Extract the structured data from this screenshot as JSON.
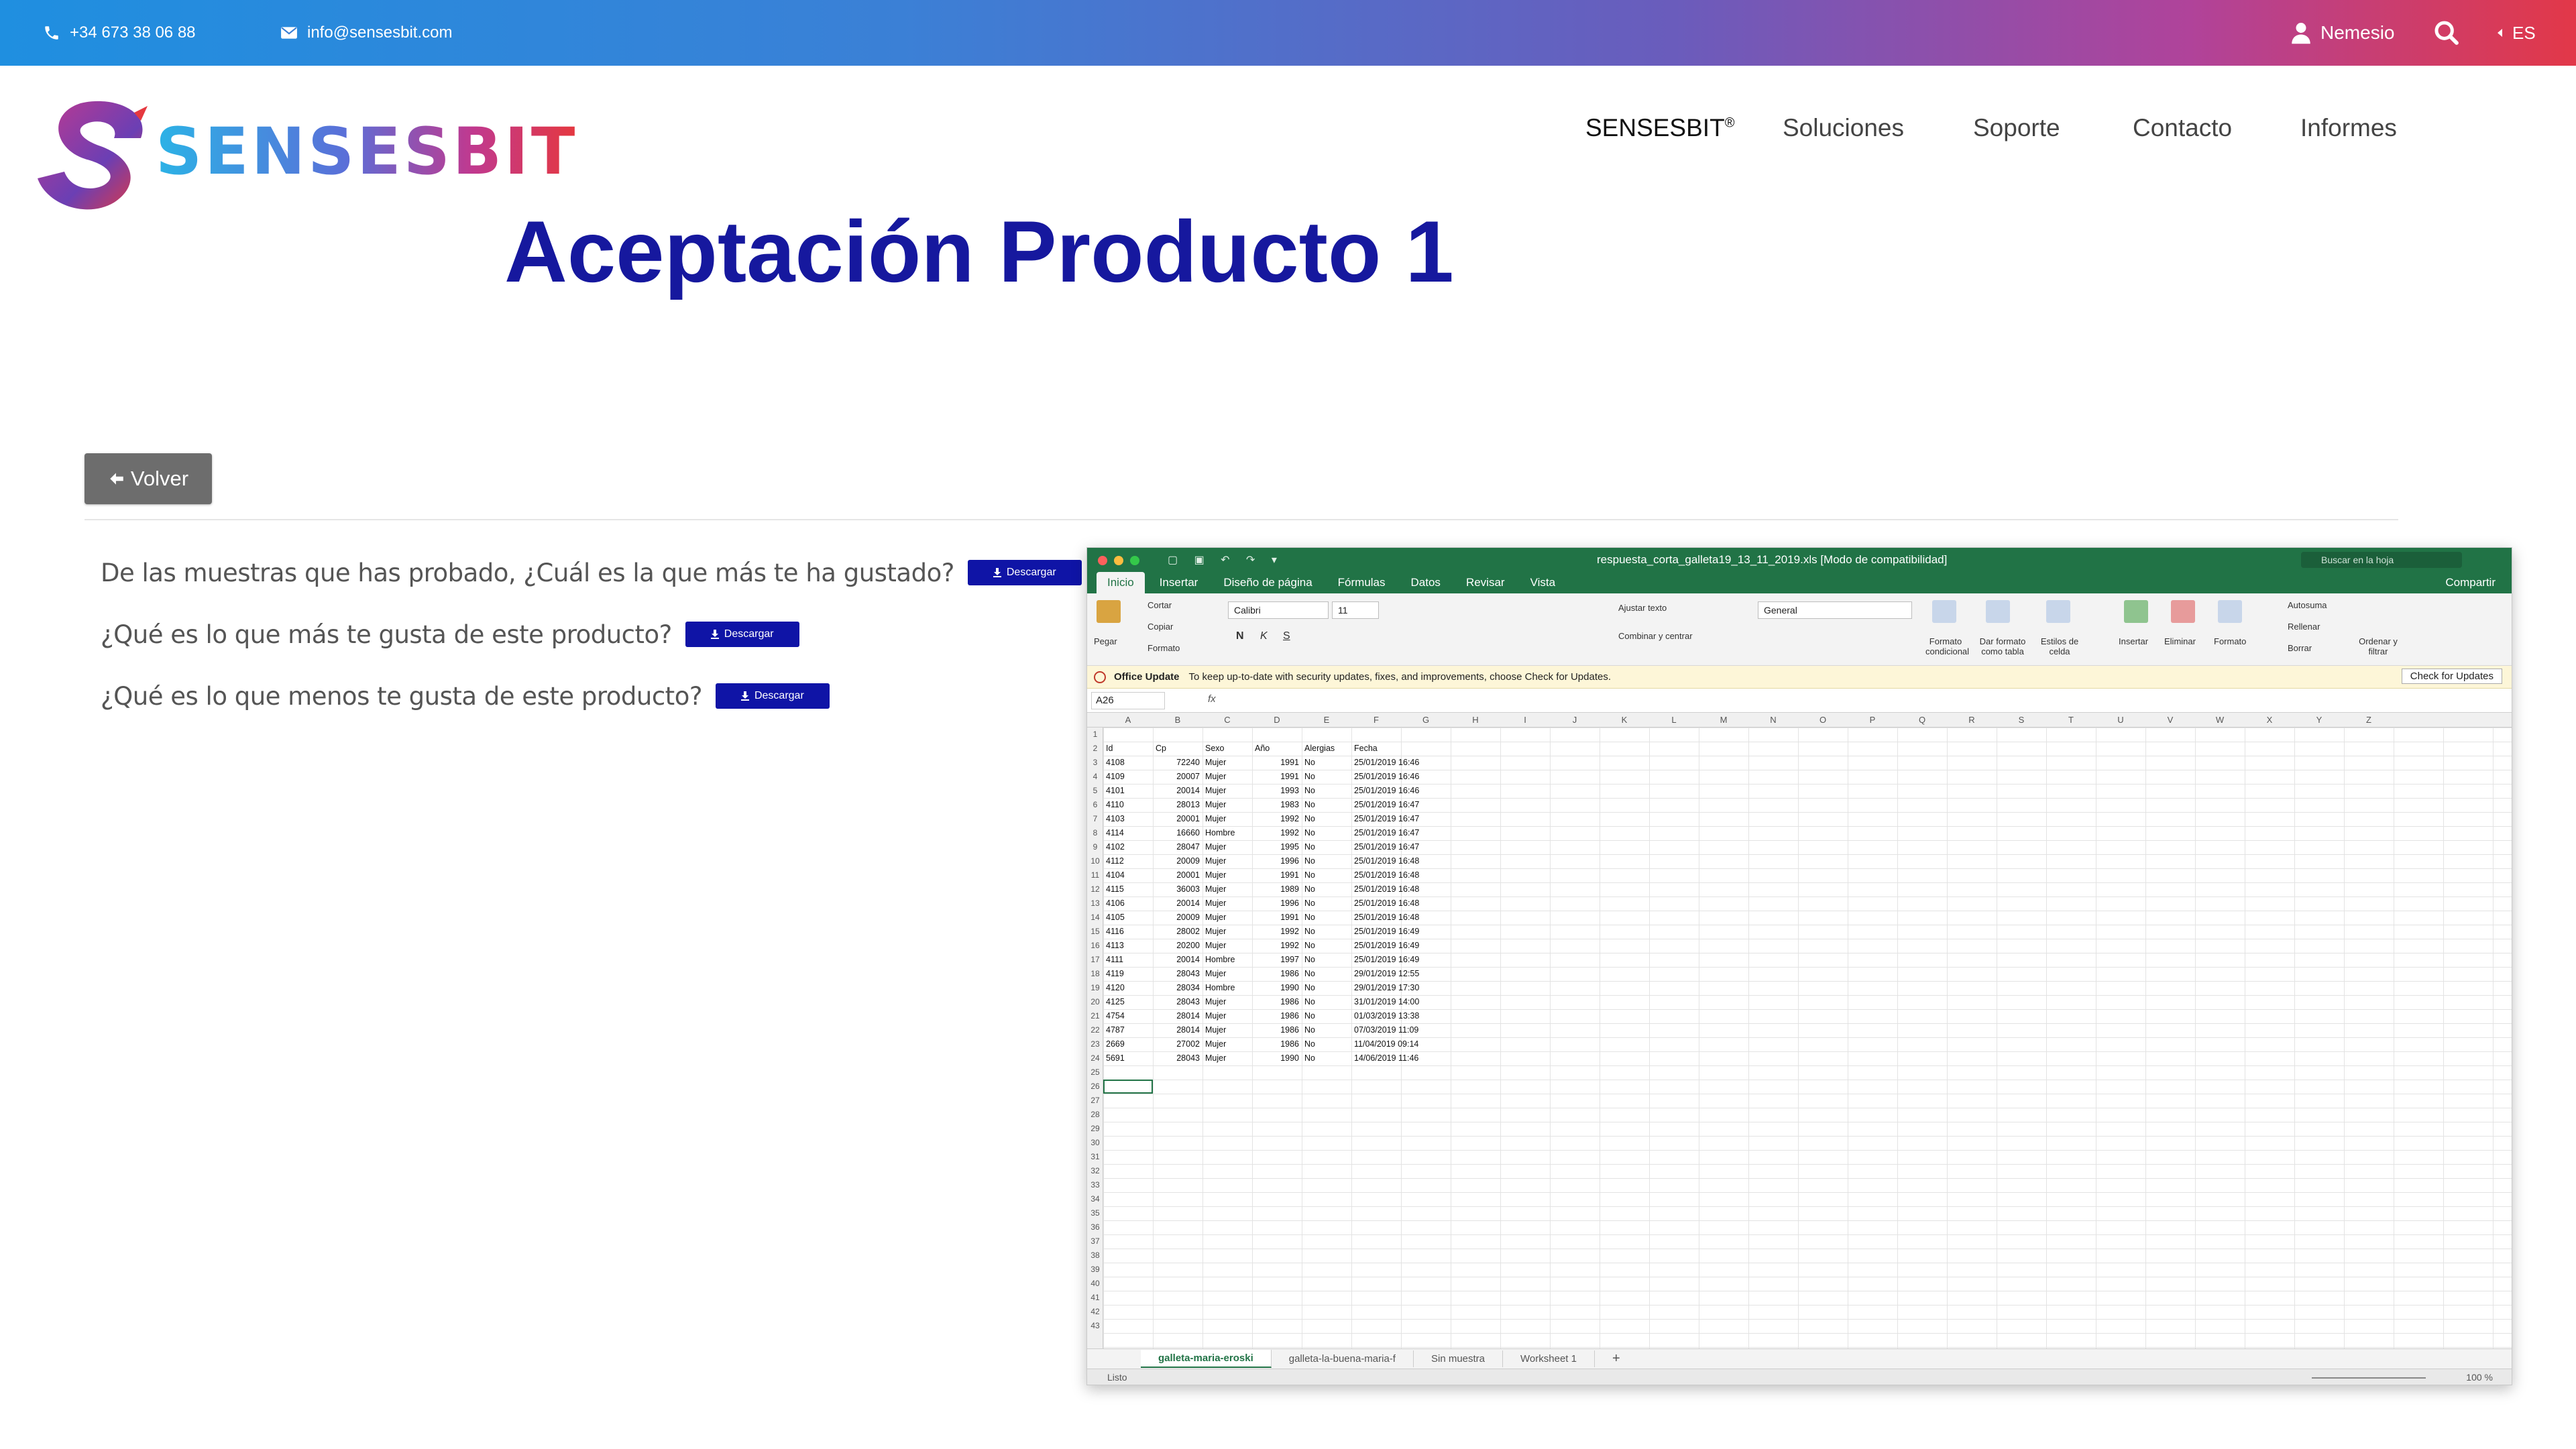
{
  "topbar": {
    "phone": "+34 673 38 06 88",
    "email": "info@sensesbit.com",
    "user": "Nemesio",
    "language": "ES",
    "icons": [
      "phone-icon",
      "mail-icon",
      "user-icon",
      "search-icon",
      "caret-left-icon"
    ]
  },
  "header": {
    "logo_text": "SENSESBIT",
    "nav": [
      {
        "label": "SENSESBIT",
        "sup": "®"
      },
      {
        "label": "Soluciones"
      },
      {
        "label": "Soporte"
      },
      {
        "label": "Contacto"
      },
      {
        "label": "Informes"
      }
    ]
  },
  "page": {
    "title": "Aceptación Producto 1",
    "back_label": "Volver"
  },
  "questions": [
    {
      "text": "De las muestras que has probado, ¿Cuál es la que más te ha gustado?",
      "button": "Descargar"
    },
    {
      "text": "¿Qué es lo que más te gusta de este producto?",
      "button": "Descargar"
    },
    {
      "text": "¿Qué es lo que menos te gusta de este producto?",
      "button": "Descargar"
    }
  ],
  "excel": {
    "document_title": "respuesta_corta_galleta19_13_11_2019.xls  [Modo de compatibilidad]",
    "search_placeholder": "Buscar en la hoja",
    "share": "Compartir",
    "tabs": [
      "Inicio",
      "Insertar",
      "Diseño de página",
      "Fórmulas",
      "Datos",
      "Revisar",
      "Vista"
    ],
    "ribbon": {
      "paste": "Pegar",
      "cut": "Cortar",
      "copy": "Copiar",
      "format_painter": "Formato",
      "font": "Calibri",
      "size": "11",
      "bold": "N",
      "italic": "K",
      "underline": "S",
      "wrap": "Ajustar texto",
      "merge": "Combinar y centrar",
      "number_format": "General",
      "cond_format": "Formato condicional",
      "table_format": "Dar formato como tabla",
      "cell_styles": "Estilos de celda",
      "insert": "Insertar",
      "delete": "Eliminar",
      "format": "Formato",
      "autosum": "Autosuma",
      "fill": "Rellenar",
      "clear": "Borrar",
      "sort": "Ordenar y filtrar"
    },
    "update_bar": {
      "title": "Office Update",
      "message": "To keep up-to-date with security updates, fixes, and improvements, choose Check for Updates.",
      "button": "Check for Updates"
    },
    "name_box": "A26",
    "fx": "fx",
    "columns": [
      "A",
      "B",
      "C",
      "D",
      "E",
      "F",
      "G",
      "H",
      "I",
      "J",
      "K",
      "L",
      "M",
      "N",
      "O",
      "P",
      "Q",
      "R",
      "S",
      "T",
      "U",
      "V",
      "W",
      "X",
      "Y",
      "Z"
    ],
    "headers": [
      "Id",
      "Cp",
      "Sexo",
      "Año",
      "Alergias",
      "Fecha"
    ],
    "rows": [
      [
        "4108",
        "72240",
        "Mujer",
        "1991",
        "No",
        "25/01/2019 16:46"
      ],
      [
        "4109",
        "20007",
        "Mujer",
        "1991",
        "No",
        "25/01/2019 16:46"
      ],
      [
        "4101",
        "20014",
        "Mujer",
        "1993",
        "No",
        "25/01/2019 16:46"
      ],
      [
        "4110",
        "28013",
        "Mujer",
        "1983",
        "No",
        "25/01/2019 16:47"
      ],
      [
        "4103",
        "20001",
        "Mujer",
        "1992",
        "No",
        "25/01/2019 16:47"
      ],
      [
        "4114",
        "16660",
        "Hombre",
        "1992",
        "No",
        "25/01/2019 16:47"
      ],
      [
        "4102",
        "28047",
        "Mujer",
        "1995",
        "No",
        "25/01/2019 16:47"
      ],
      [
        "4112",
        "20009",
        "Mujer",
        "1996",
        "No",
        "25/01/2019 16:48"
      ],
      [
        "4104",
        "20001",
        "Mujer",
        "1991",
        "No",
        "25/01/2019 16:48"
      ],
      [
        "4115",
        "36003",
        "Mujer",
        "1989",
        "No",
        "25/01/2019 16:48"
      ],
      [
        "4106",
        "20014",
        "Mujer",
        "1996",
        "No",
        "25/01/2019 16:48"
      ],
      [
        "4105",
        "20009",
        "Mujer",
        "1991",
        "No",
        "25/01/2019 16:48"
      ],
      [
        "4116",
        "28002",
        "Mujer",
        "1992",
        "No",
        "25/01/2019 16:49"
      ],
      [
        "4113",
        "20200",
        "Mujer",
        "1992",
        "No",
        "25/01/2019 16:49"
      ],
      [
        "4111",
        "20014",
        "Hombre",
        "1997",
        "No",
        "25/01/2019 16:49"
      ],
      [
        "4119",
        "28043",
        "Mujer",
        "1986",
        "No",
        "29/01/2019 12:55"
      ],
      [
        "4120",
        "28034",
        "Hombre",
        "1990",
        "No",
        "29/01/2019 17:30"
      ],
      [
        "4125",
        "28043",
        "Mujer",
        "1986",
        "No",
        "31/01/2019 14:00"
      ],
      [
        "4754",
        "28014",
        "Mujer",
        "1986",
        "No",
        "01/03/2019 13:38"
      ],
      [
        "4787",
        "28014",
        "Mujer",
        "1986",
        "No",
        "07/03/2019 11:09"
      ],
      [
        "2669",
        "27002",
        "Mujer",
        "1986",
        "No",
        "11/04/2019 09:14"
      ],
      [
        "5691",
        "28043",
        "Mujer",
        "1990",
        "No",
        "14/06/2019 11:46"
      ]
    ],
    "row_count": 43,
    "sheets": [
      "galleta-maria-eroski",
      "galleta-la-buena-maria-f",
      "Sin muestra",
      "Worksheet 1"
    ],
    "add_sheet": "+",
    "status": "Listo",
    "zoom": "100 %"
  },
  "colors": {
    "title_blue": "#16189e",
    "download_blue": "#0f14a6",
    "excel_green": "#217346",
    "back_gray": "#6d6d6d"
  }
}
